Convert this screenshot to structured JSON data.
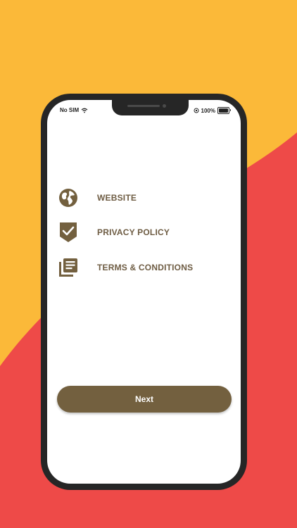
{
  "colors": {
    "background_yellow": "#FBB939",
    "background_red": "#EE4A48",
    "phone_frame": "#262626",
    "accent_brown": "#73603F",
    "label_brown": "#6E5C43"
  },
  "status_bar": {
    "carrier": "No SIM",
    "battery": "100%"
  },
  "menu": {
    "items": [
      {
        "label": "WEBSITE",
        "icon": "globe-icon"
      },
      {
        "label": "PRIVACY POLICY",
        "icon": "shield-check-icon"
      },
      {
        "label": "TERMS & CONDITIONS",
        "icon": "document-list-icon"
      }
    ]
  },
  "actions": {
    "next_label": "Next"
  }
}
